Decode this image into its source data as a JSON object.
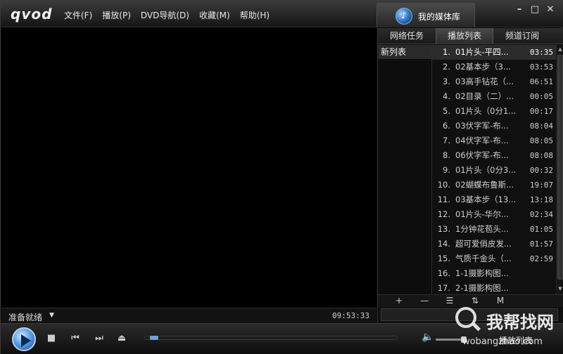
{
  "app": {
    "logo": "qvod",
    "menu": [
      "文件(F)",
      "播放(P)",
      "DVD导航(D)",
      "收藏(M)",
      "帮助(H)"
    ],
    "media_library_tab": "我的媒体库",
    "window_buttons": {
      "minimize": "–",
      "maximize": "□",
      "close": "✕"
    }
  },
  "panel": {
    "tabs": [
      "网络任务",
      "播放列表",
      "频道订阅"
    ],
    "active_tab": "播放列表",
    "lists": [
      "新列表"
    ],
    "tracks": [
      {
        "num": "1.",
        "title": "01片头-平四...",
        "time": "03:35"
      },
      {
        "num": "2.",
        "title": "02基本步（3...",
        "time": "03:53"
      },
      {
        "num": "3.",
        "title": "03高手钻花（...",
        "time": "06:51"
      },
      {
        "num": "4.",
        "title": "02目录（二）...",
        "time": "00:05"
      },
      {
        "num": "5.",
        "title": "01片头（0分1...",
        "time": "00:17"
      },
      {
        "num": "6.",
        "title": "03伏字军-布...",
        "time": "08:04"
      },
      {
        "num": "7.",
        "title": "04伏字军-布...",
        "time": "08:05"
      },
      {
        "num": "8.",
        "title": "06伏字军-布...",
        "time": "08:08"
      },
      {
        "num": "9.",
        "title": "01片头（0分3...",
        "time": "00:32"
      },
      {
        "num": "10.",
        "title": "02蝴蝶布鲁斯...",
        "time": "19:07"
      },
      {
        "num": "11.",
        "title": "03基本步（13...",
        "time": "13:18"
      },
      {
        "num": "12.",
        "title": "01片头-华尔...",
        "time": "02:34"
      },
      {
        "num": "13.",
        "title": "1分钟花苞头...",
        "time": "01:05"
      },
      {
        "num": "14.",
        "title": "超可爱俏皮发...",
        "time": "01:57"
      },
      {
        "num": "15.",
        "title": "气质千金头（...",
        "time": "02:59"
      },
      {
        "num": "16.",
        "title": "1-1摄影构图...",
        "time": ""
      },
      {
        "num": "17.",
        "title": "2-1摄影构图...",
        "time": ""
      }
    ],
    "tools": [
      "+",
      "—",
      "☰",
      "⇅",
      "M"
    ]
  },
  "status": {
    "text": "准备就绪",
    "clock": "09:53:33"
  },
  "controls": {
    "playlist_toggle": "播放列表",
    "progress": 0.02
  },
  "watermark": {
    "text": "我帮找网",
    "url": "wobangzhao.com"
  },
  "colors": {
    "accent": "#5aa0e8",
    "background": "#0a0a0a",
    "panel": "#101010"
  }
}
